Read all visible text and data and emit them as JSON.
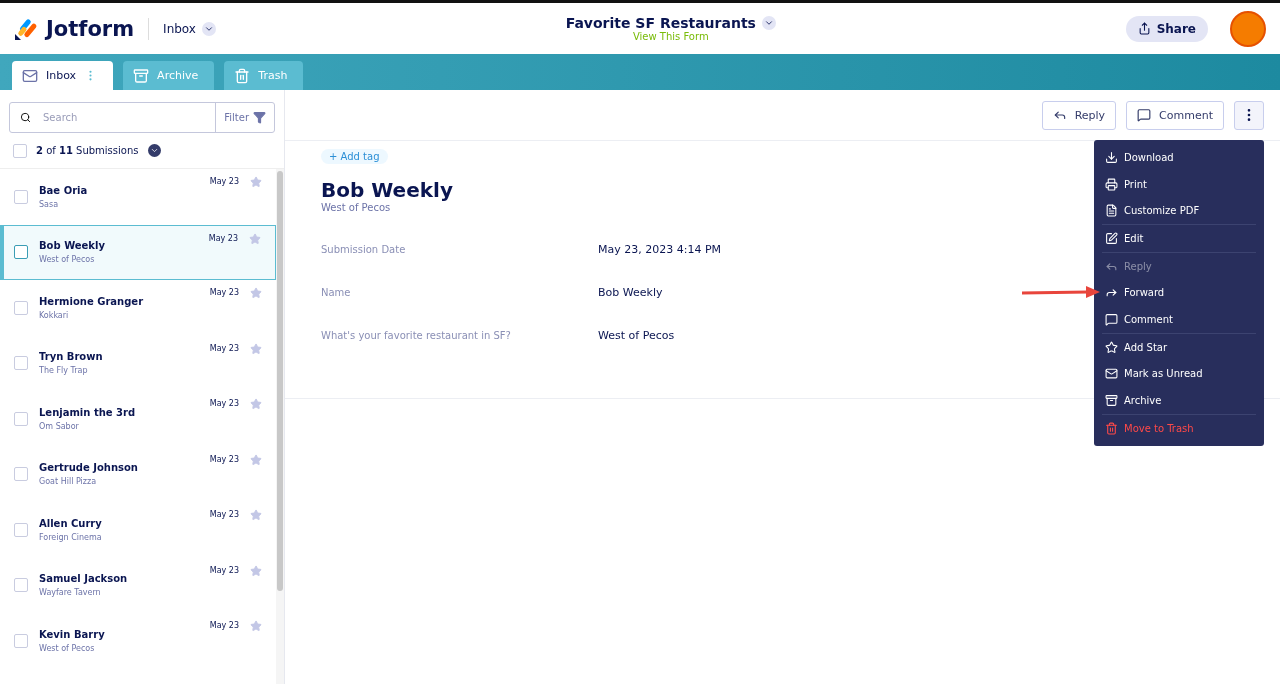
{
  "header": {
    "brand": "Jotform",
    "section": "Inbox",
    "form_title": "Favorite SF Restaurants",
    "form_link": "View This Form",
    "share": "Share"
  },
  "tabs": [
    {
      "label": "Inbox",
      "selected": true
    },
    {
      "label": "Archive",
      "selected": false
    },
    {
      "label": "Trash",
      "selected": false
    }
  ],
  "sidebar": {
    "search": {
      "placeholder": "Search"
    },
    "filter": "Filter",
    "count": "**2** of **11** Submissions",
    "select_all_checked": false,
    "items": [
      {
        "name": "Bae Oria",
        "subtitle": "Sasa",
        "date": "May 23",
        "selected": false,
        "checked": false,
        "starred": false
      },
      {
        "name": "Bob Weekly",
        "subtitle": "West of Pecos",
        "date": "May 23",
        "selected": true,
        "checked": false,
        "starred": false
      },
      {
        "name": "Hermione Granger",
        "subtitle": "Kokkari",
        "date": "May 23",
        "selected": false,
        "checked": false,
        "starred": false
      },
      {
        "name": "Tryn Brown",
        "subtitle": "The Fly Trap",
        "date": "May 23",
        "selected": false,
        "checked": false,
        "starred": false
      },
      {
        "name": "Lenjamin the 3rd",
        "subtitle": "Om Sabor",
        "date": "May 23",
        "selected": false,
        "checked": false,
        "starred": false
      },
      {
        "name": "Gertrude Johnson",
        "subtitle": "Goat Hill Pizza",
        "date": "May 23",
        "selected": false,
        "checked": false,
        "starred": false
      },
      {
        "name": "Allen Curry",
        "subtitle": "Foreign Cinema",
        "date": "May 23",
        "selected": false,
        "checked": false,
        "starred": false
      },
      {
        "name": "Samuel Jackson",
        "subtitle": "Wayfare Tavern",
        "date": "May 23",
        "selected": false,
        "checked": false,
        "starred": false
      },
      {
        "name": "Kevin Barry",
        "subtitle": "West of Pecos",
        "date": "May 23",
        "selected": false,
        "checked": false,
        "starred": false
      }
    ]
  },
  "toolbar": {
    "reply": "Reply",
    "comment": "Comment"
  },
  "detail": {
    "add_tag": "+ Add tag",
    "title": "Bob Weekly",
    "subtitle": "West of Pecos",
    "fields": [
      {
        "label": "Submission Date",
        "value": "May 23, 2023 4:14 PM"
      },
      {
        "label": "Name",
        "value": "Bob Weekly"
      },
      {
        "label": "What's your favorite restaurant in SF?",
        "value": "West of Pecos"
      }
    ]
  },
  "menu": {
    "sections": [
      [
        {
          "label": "Download",
          "disabled": false,
          "destructive": false
        },
        {
          "label": "Print",
          "disabled": false,
          "destructive": false
        },
        {
          "label": "Customize PDF",
          "disabled": false,
          "destructive": false
        }
      ],
      [
        {
          "label": "Edit",
          "disabled": false,
          "destructive": false
        }
      ],
      [
        {
          "label": "Reply",
          "disabled": true,
          "destructive": false
        },
        {
          "label": "Forward",
          "disabled": false,
          "destructive": false,
          "highlighted": true
        },
        {
          "label": "Comment",
          "disabled": false,
          "destructive": false
        }
      ],
      [
        {
          "label": "Add Star",
          "disabled": false,
          "destructive": false
        },
        {
          "label": "Mark as Unread",
          "disabled": false,
          "destructive": false
        },
        {
          "label": "Archive",
          "disabled": false,
          "destructive": false
        }
      ],
      [
        {
          "label": "Move to Trash",
          "disabled": false,
          "destructive": true
        }
      ]
    ]
  }
}
